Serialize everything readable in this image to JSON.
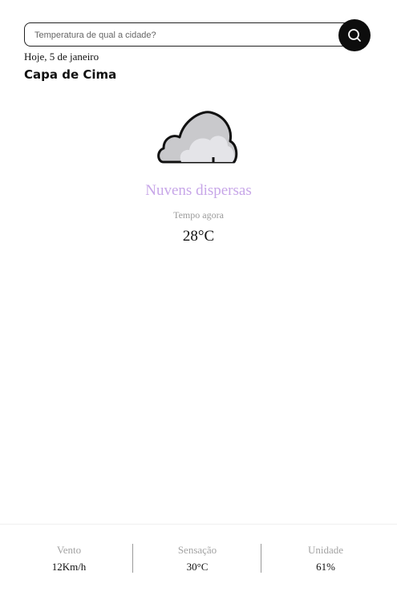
{
  "search": {
    "placeholder": "Temperatura de qual a cidade?",
    "button_icon": "search-icon"
  },
  "header": {
    "date": "Hoje, 5 de janeiro",
    "city": "Capa de Cima"
  },
  "weather": {
    "icon": "cloud-icon",
    "description": "Nuvens dispersas",
    "subtitle": "Tempo agora",
    "temperature": "28°C"
  },
  "stats": [
    {
      "label": "Vento",
      "value": "12Km/h"
    },
    {
      "label": "Sensação",
      "value": "30°C"
    },
    {
      "label": "Unidade",
      "value": "61%"
    }
  ],
  "colors": {
    "description": "#c7a6e8",
    "search_button": "#0d0d0d",
    "muted_label": "#a3a3a3"
  }
}
